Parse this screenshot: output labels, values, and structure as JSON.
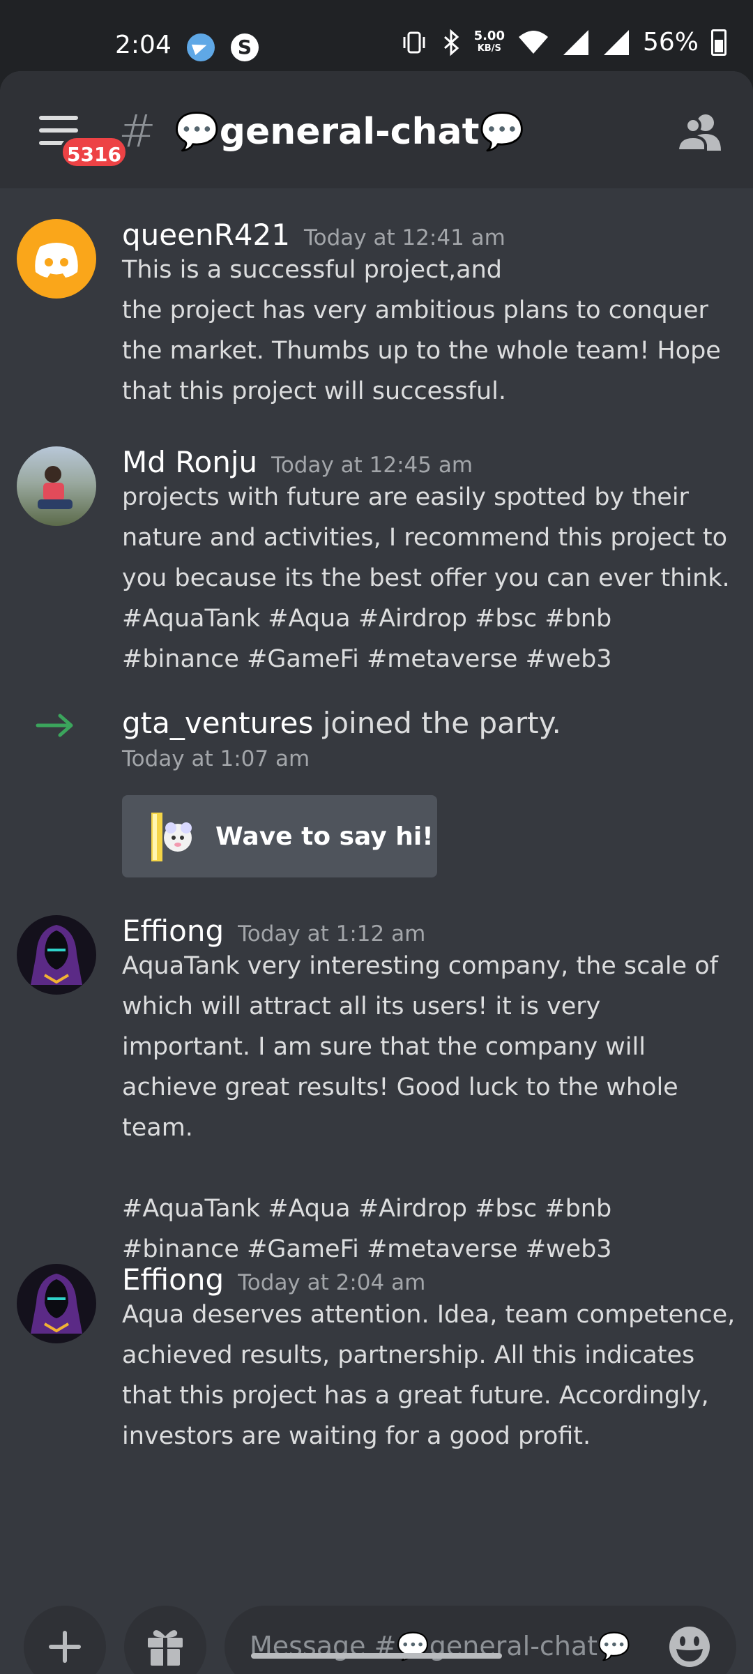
{
  "status_bar": {
    "time": "2:04",
    "network_speed_value": "5.00",
    "network_speed_unit": "KB/S",
    "battery": "56%",
    "icons": [
      "telegram-icon",
      "s-app-icon",
      "vibrate-icon",
      "bluetooth-icon",
      "wifi-icon",
      "signal-icon",
      "signal-icon",
      "battery-icon"
    ]
  },
  "header": {
    "menu_badge": "5316",
    "hash": "#",
    "channel_name": "💬general-chat💬"
  },
  "messages": [
    {
      "author": "queenR421",
      "time": "Today at 12:41 am",
      "text": "This is a successful project,and\nthe project has very ambitious plans to conquer the market. Thumbs up to the whole team! Hope that this project will successful."
    },
    {
      "author": "Md Ronju",
      "time": "Today at 12:45 am",
      "text": "projects with future are easily spotted by their nature and activities, I recommend this project to you because its the best offer you can ever think. #AquaTank #Aqua #Airdrop #bsc #bnb #binance #GameFi #metaverse #web3"
    },
    {
      "author": "Effiong",
      "time": "Today at 1:12 am",
      "text": "AquaTank very interesting company, the scale of which will attract all its users! it is very important. I am sure that the company will achieve great results! Good luck to the whole team.\n\n#AquaTank #Aqua #Airdrop #bsc #bnb #binance #GameFi #metaverse #web3"
    },
    {
      "author": "Effiong",
      "time": "Today at 2:04 am",
      "text": "Aqua deserves attention. Idea, team competence, achieved results, partnership. All this indicates that this project has a great future. Accordingly, investors are waiting for a good profit."
    }
  ],
  "join_event": {
    "username": "gta_ventures",
    "text": " joined the party.",
    "time": "Today at 1:07 am",
    "wave_button": "Wave to say hi!"
  },
  "composer": {
    "placeholder": "Message #💬general-chat💬"
  },
  "colors": {
    "background": "#36393f",
    "header": "#2f3136",
    "discord_avatar": "#faa61a",
    "join_arrow": "#3ba55c",
    "badge": "#ed4245"
  }
}
